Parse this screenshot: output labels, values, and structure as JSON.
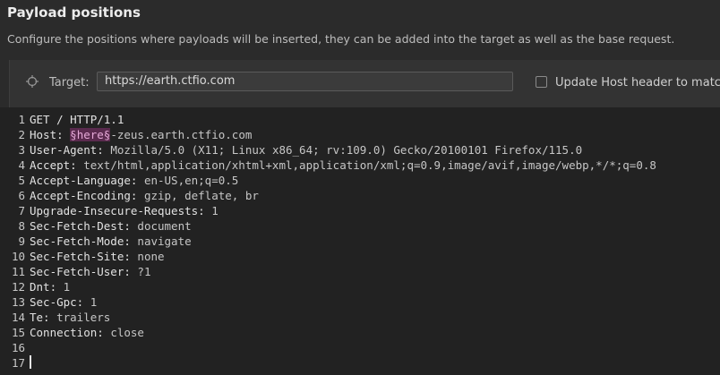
{
  "header": {
    "title": "Payload positions",
    "subtitle": "Configure the positions where payloads will be inserted, they can be added into the target as well as the base request."
  },
  "target": {
    "label": "Target:",
    "value": "https://earth.ctfio.com",
    "checkbox_label": "Update Host header to match t",
    "checkbox_checked": false
  },
  "editor": {
    "lines": [
      {
        "n": "1",
        "key": "GET / HTTP/1.1",
        "sep": "",
        "value": ""
      },
      {
        "n": "2",
        "key": "Host:",
        "sep": " ",
        "marker": "§here§",
        "value": "-zeus.earth.ctfio.com"
      },
      {
        "n": "3",
        "key": "User-Agent:",
        "sep": " ",
        "value": "Mozilla/5.0 (X11; Linux x86_64; rv:109.0) Gecko/20100101 Firefox/115.0"
      },
      {
        "n": "4",
        "key": "Accept:",
        "sep": " ",
        "value": "text/html,application/xhtml+xml,application/xml;q=0.9,image/avif,image/webp,*/*;q=0.8"
      },
      {
        "n": "5",
        "key": "Accept-Language:",
        "sep": " ",
        "value": "en-US,en;q=0.5"
      },
      {
        "n": "6",
        "key": "Accept-Encoding:",
        "sep": " ",
        "value": "gzip, deflate, br"
      },
      {
        "n": "7",
        "key": "Upgrade-Insecure-Requests:",
        "sep": " ",
        "value": "1"
      },
      {
        "n": "8",
        "key": "Sec-Fetch-Dest:",
        "sep": " ",
        "value": "document"
      },
      {
        "n": "9",
        "key": "Sec-Fetch-Mode:",
        "sep": " ",
        "value": "navigate"
      },
      {
        "n": "10",
        "key": "Sec-Fetch-Site:",
        "sep": " ",
        "value": "none"
      },
      {
        "n": "11",
        "key": "Sec-Fetch-User:",
        "sep": " ",
        "value": "?1"
      },
      {
        "n": "12",
        "key": "Dnt:",
        "sep": " ",
        "value": "1"
      },
      {
        "n": "13",
        "key": "Sec-Gpc:",
        "sep": " ",
        "value": "1"
      },
      {
        "n": "14",
        "key": "Te:",
        "sep": " ",
        "value": "trailers"
      },
      {
        "n": "15",
        "key": "Connection:",
        "sep": " ",
        "value": "close"
      },
      {
        "n": "16",
        "key": "",
        "sep": "",
        "value": ""
      },
      {
        "n": "17",
        "key": "",
        "sep": "",
        "value": ""
      }
    ]
  },
  "colors": {
    "background": "#2b2b2b",
    "editor_background": "#222222",
    "payload_marker_bg": "#5a2a4e",
    "payload_marker_fg": "#e6a9d8"
  },
  "icons": {
    "target": "crosshair-icon"
  }
}
